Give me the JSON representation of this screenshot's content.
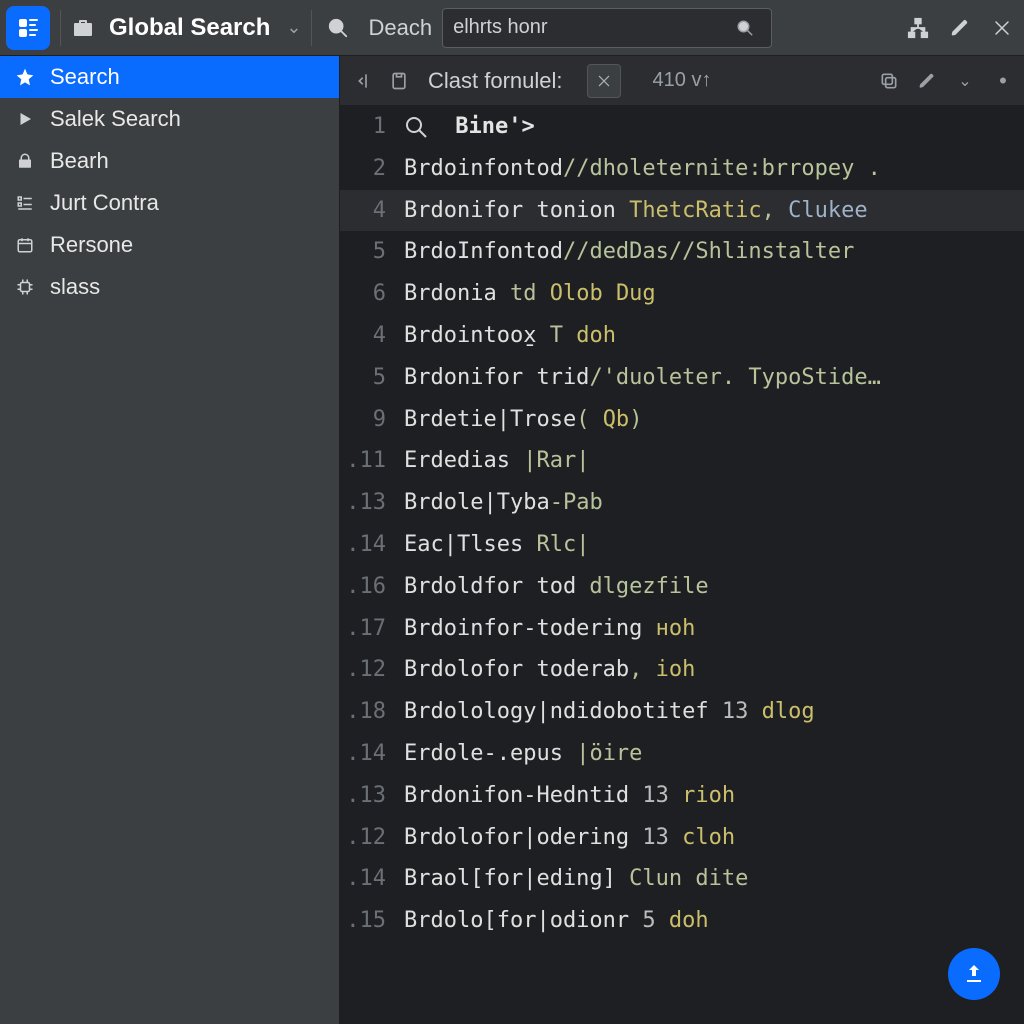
{
  "topbar": {
    "title": "Global Search",
    "section_label": "Deach",
    "search_value": "elhrts honr"
  },
  "sidebar": {
    "items": [
      {
        "icon": "star",
        "label": "Search",
        "active": true
      },
      {
        "icon": "play",
        "label": "Salek Search",
        "active": false
      },
      {
        "icon": "lock",
        "label": "Bearh",
        "active": false
      },
      {
        "icon": "list",
        "label": "Jurt Contra",
        "active": false
      },
      {
        "icon": "calendar",
        "label": "Rersone",
        "active": false
      },
      {
        "icon": "chip",
        "label": "slass",
        "active": false
      }
    ]
  },
  "tab": {
    "title": "Clast fornulel:",
    "badge": "410 v↑"
  },
  "editor": {
    "lines": [
      {
        "n": "1",
        "raw": "__ICON__ __H1__Bine'>__/H1__",
        "hl": false
      },
      {
        "n": "2",
        "raw": "__KW__Brdoinfontod__/KW__//dholeternite:brropey .",
        "hl": false
      },
      {
        "n": "4",
        "raw": "__KW__Brdonifor tonion__/KW__ __HI1__ThetcRatic__/HI1__, __HI2__Clukee__/HI2__ ",
        "hl": true
      },
      {
        "n": "5",
        "raw": "__KW__BrdoInfontod__/KW__//dedDas//Shlinstalter ",
        "hl": false
      },
      {
        "n": "6",
        "raw": "__KW__Brdonia__/KW__ td __HI1__Olob__/HI1__ __HI1__Dug__/HI1__",
        "hl": false
      },
      {
        "n": "4",
        "raw": "__KW__Brdointoox̱__/KW__ T  __HI1__doh__/HI1__",
        "hl": false
      },
      {
        "n": "5",
        "raw": "__KW__Brdonifor trid__/KW__/'duoleter. TypoStide…",
        "hl": false
      },
      {
        "n": "9",
        "raw": "__KW__Brdetie|Trose__/KW__( __HI1__Qb__/HI1__)",
        "hl": false
      },
      {
        "n": ".11",
        "raw": "__KW__Erdedias__/KW__ |Rar|",
        "hl": false
      },
      {
        "n": ".13",
        "raw": "__KW__Brdole|Tyba__/KW__-Pab",
        "hl": false
      },
      {
        "n": ".14",
        "raw": "__KW__Eac|Tlses__/KW__ Rlc|",
        "hl": false
      },
      {
        "n": ".16",
        "raw": "__KW__Brdoldfor tod__/KW__ dlgezfile",
        "hl": false
      },
      {
        "n": ".17",
        "raw": "__KW__Brdoinfor-todering__/KW__  __HI1__нoh__/HI1__",
        "hl": false
      },
      {
        "n": ".12",
        "raw": "__KW__Brdolofor toderab__/KW__, __HI1__ioh__/HI1__",
        "hl": false
      },
      {
        "n": ".18",
        "raw": "__KW__Brdolology|ndidobotitef__/KW__ __NUM__13__/NUM__  __HI1__dlog__/HI1__",
        "hl": false
      },
      {
        "n": ".14",
        "raw": "__KW__Erdole-.epus__/KW__ |öire",
        "hl": false
      },
      {
        "n": ".13",
        "raw": "__KW__Brdonifon-Hedntid__/KW__ __NUM__13__/NUM__  __HI1__rioh__/HI1__",
        "hl": false
      },
      {
        "n": ".12",
        "raw": "__KW__Brdolofor|odering__/KW__ __NUM__13__/NUM__  __HI1__cloh__/HI1__",
        "hl": false
      },
      {
        "n": ".14",
        "raw": "__KW__Braol[for|eding]__/KW__ Clun  dite",
        "hl": false
      },
      {
        "n": ".15",
        "raw": "__KW__Brdolo[for|odionr__/KW__ __NUM__5__/NUM__  __HI1__doh__/HI1__",
        "hl": false
      }
    ]
  }
}
